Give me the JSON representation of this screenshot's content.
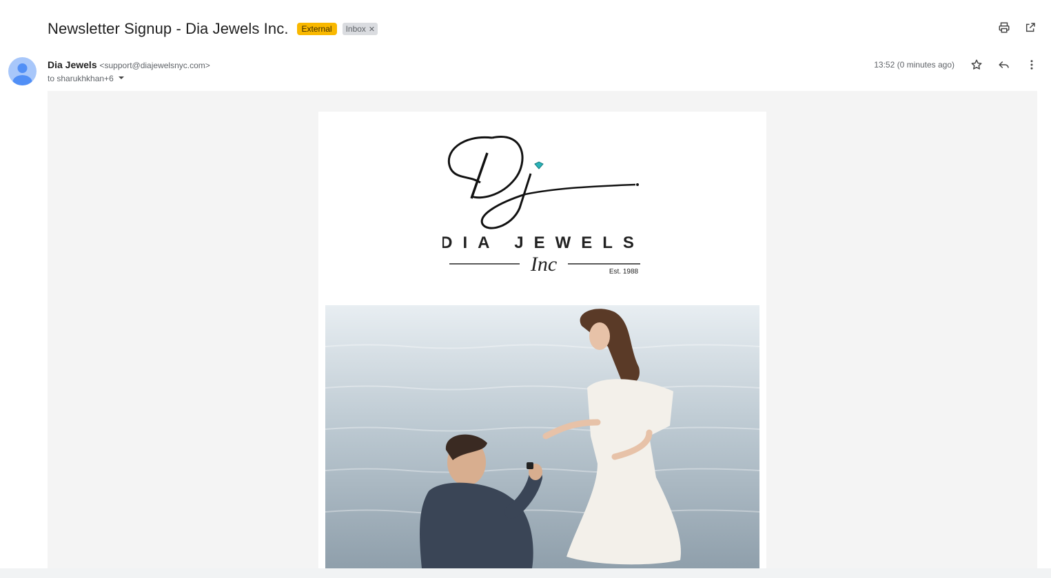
{
  "email": {
    "subject": "Newsletter Signup - Dia Jewels Inc.",
    "labels": {
      "external": "External",
      "inbox": "Inbox"
    },
    "sender_name": "Dia Jewels",
    "sender_email": "<support@diajewelsnyc.com>",
    "recipients": "to sharukhkhan+6",
    "timestamp": "13:52 (0 minutes ago)"
  },
  "icons": [
    "print-icon",
    "open-new-window-icon",
    "star-icon",
    "reply-icon",
    "more-vert-icon",
    "chevron-down-icon",
    "close-icon"
  ],
  "newsletter": {
    "logo_monogram": "Dj",
    "logo_brand": "DIA JEWELS",
    "logo_sub": "Inc",
    "logo_est": "Est. 1988"
  },
  "colors": {
    "external_label": "#f9b800",
    "gem_accent": "#2bb3b8",
    "body_bg": "#f4f4f4"
  }
}
